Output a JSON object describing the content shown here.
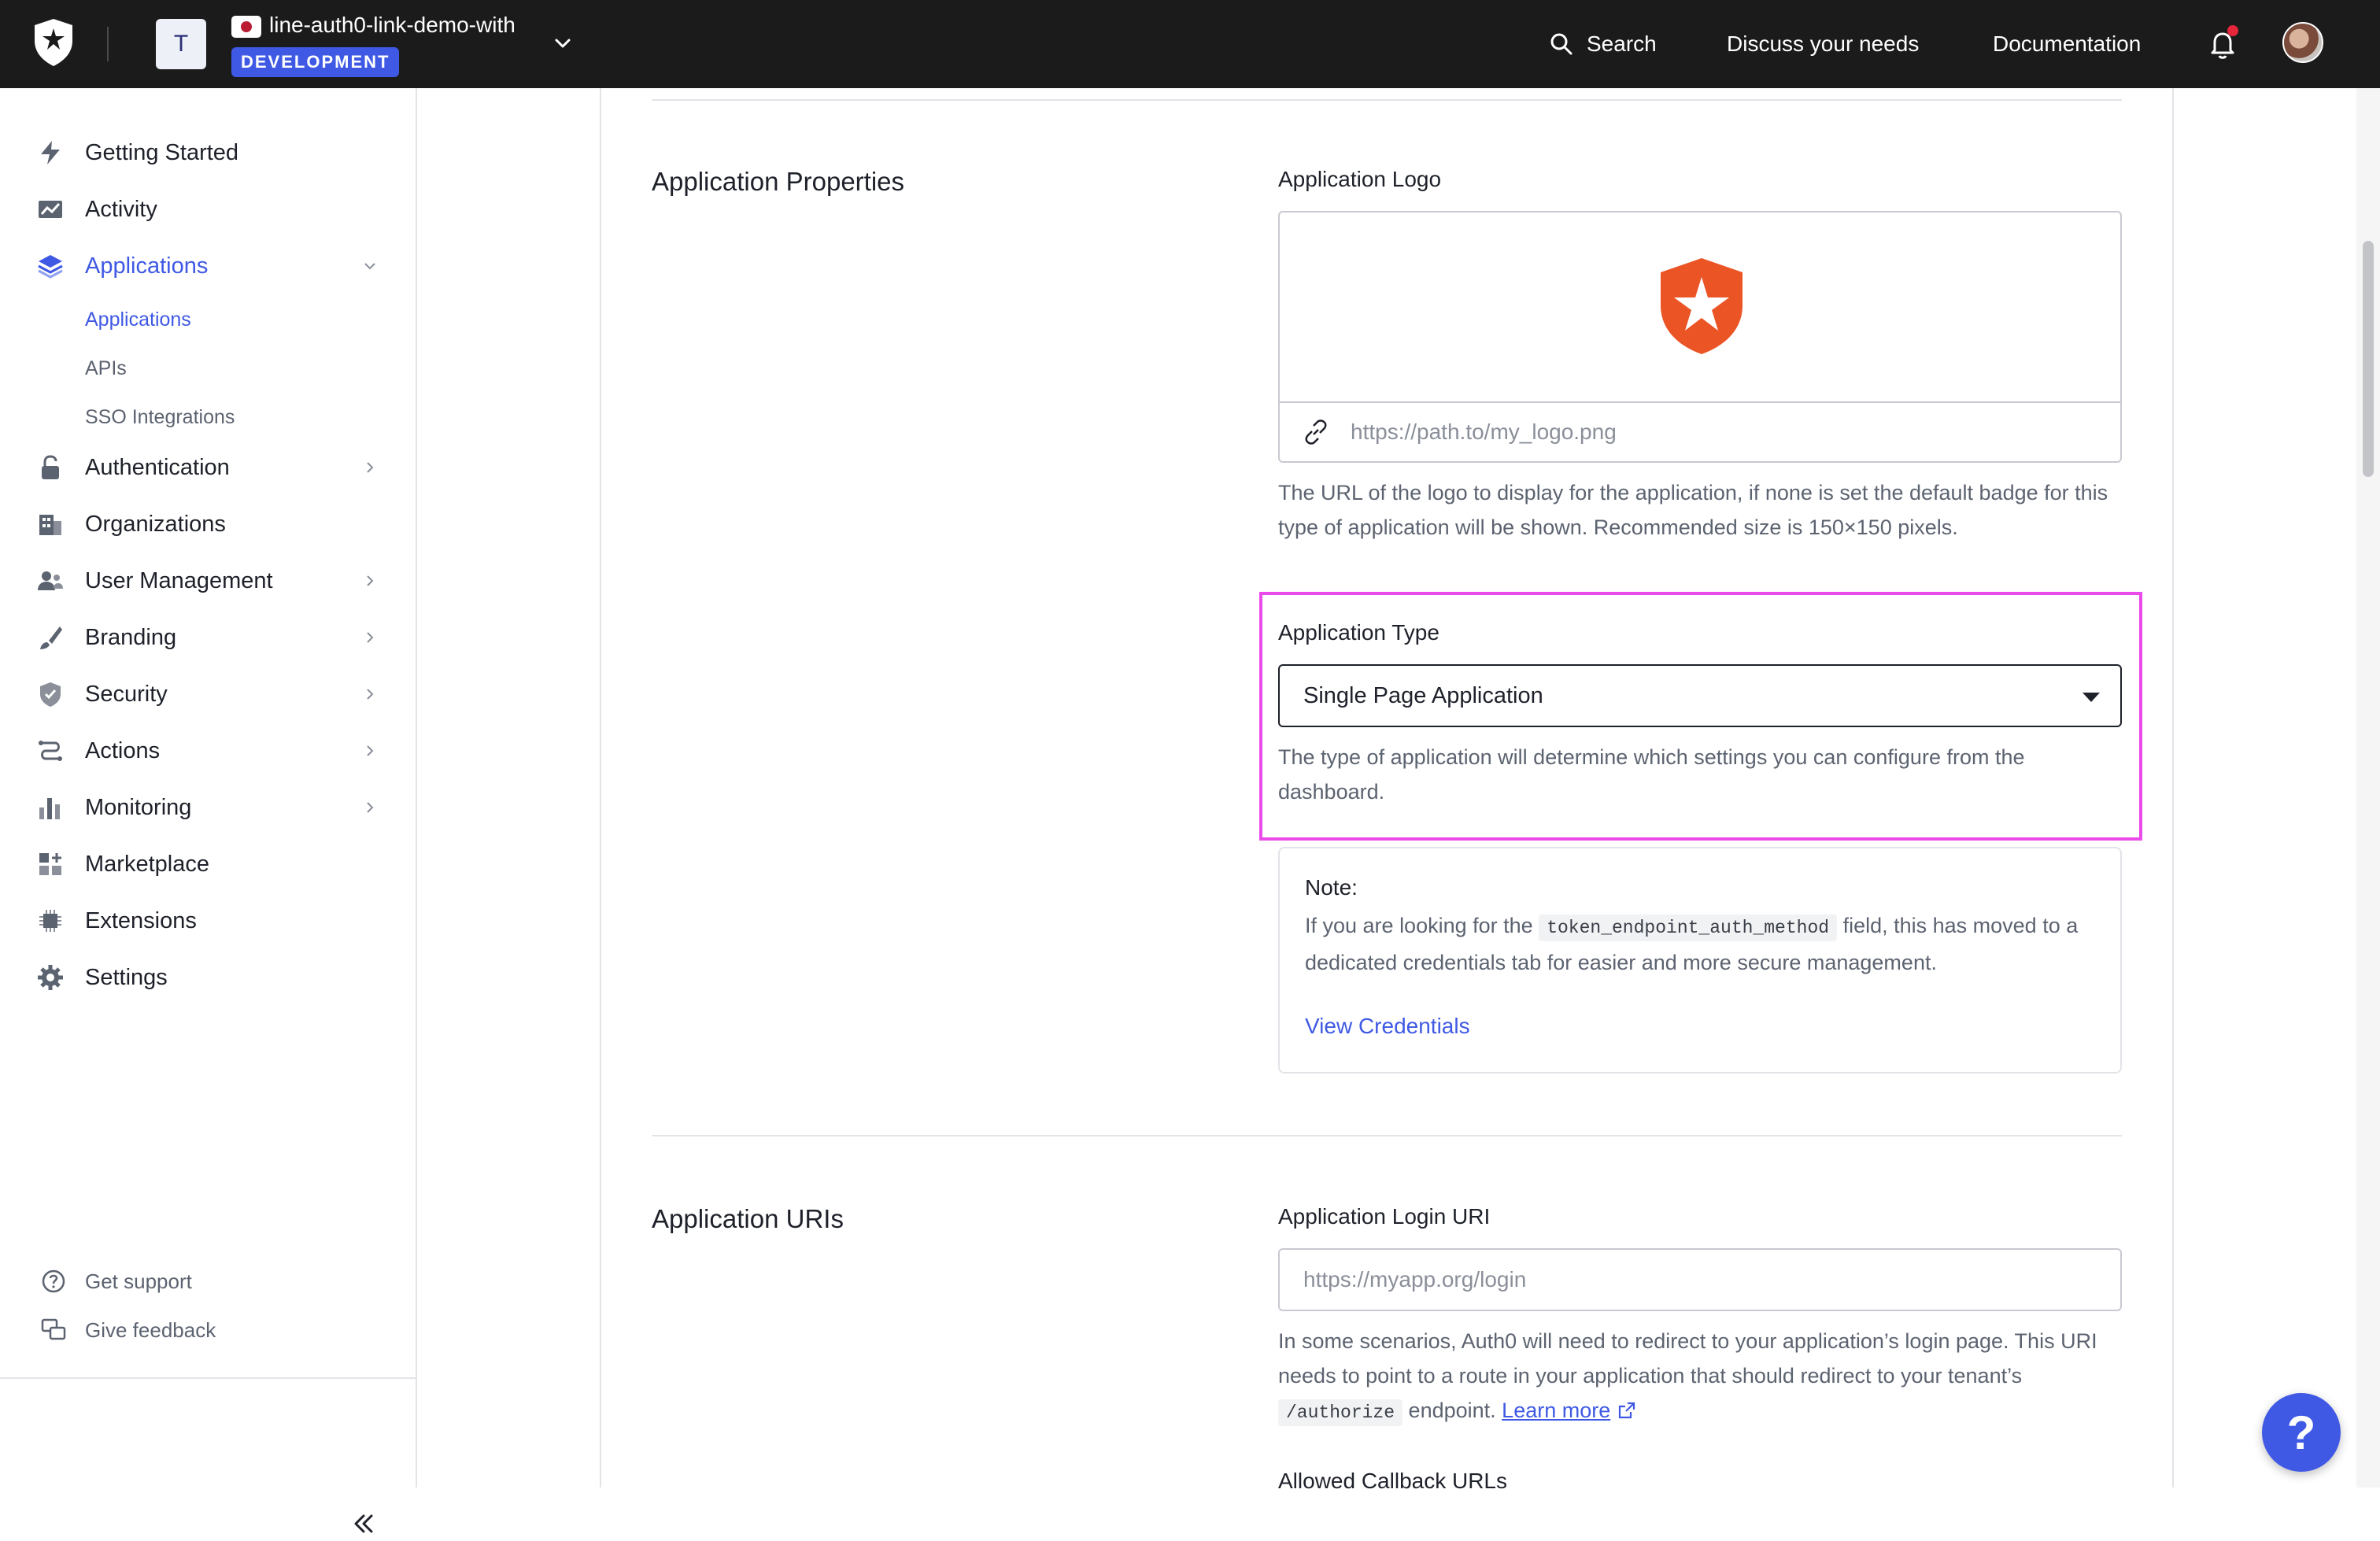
{
  "topbar": {
    "tenant_initial": "T",
    "tenant_name": "line-auth0-link-demo-with",
    "env_badge": "DEVELOPMENT",
    "search_label": "Search",
    "discuss_label": "Discuss your needs",
    "docs_label": "Documentation"
  },
  "sidebar": {
    "items": [
      {
        "label": "Getting Started",
        "icon": "bolt-icon"
      },
      {
        "label": "Activity",
        "icon": "chart-line-icon"
      },
      {
        "label": "Applications",
        "icon": "layers-icon",
        "active": true
      },
      {
        "label": "Authentication",
        "icon": "lock-icon"
      },
      {
        "label": "Organizations",
        "icon": "building-icon"
      },
      {
        "label": "User Management",
        "icon": "users-icon"
      },
      {
        "label": "Branding",
        "icon": "brush-icon"
      },
      {
        "label": "Security",
        "icon": "shield-icon"
      },
      {
        "label": "Actions",
        "icon": "flow-icon"
      },
      {
        "label": "Monitoring",
        "icon": "bar-chart-icon"
      },
      {
        "label": "Marketplace",
        "icon": "grid-plus-icon"
      },
      {
        "label": "Extensions",
        "icon": "chip-icon"
      },
      {
        "label": "Settings",
        "icon": "gear-icon"
      }
    ],
    "sub_items": [
      {
        "label": "Applications",
        "active": true
      },
      {
        "label": "APIs"
      },
      {
        "label": "SSO Integrations"
      }
    ],
    "support": {
      "get_support": "Get support",
      "give_feedback": "Give feedback"
    }
  },
  "main": {
    "properties_title": "Application Properties",
    "logo_label": "Application Logo",
    "logo_placeholder": "https://path.to/my_logo.png",
    "logo_help": "The URL of the logo to display for the application, if none is set the default badge for this type of application will be shown. Recommended size is 150×150 pixels.",
    "type_label": "Application Type",
    "type_value": "Single Page Application",
    "type_help": "The type of application will determine which settings you can configure from the dashboard.",
    "note_title": "Note:",
    "note_text_before": "If you are looking for the",
    "note_code": "token_endpoint_auth_method",
    "note_text_after": "field, this has moved to a dedicated credentials tab for easier and more secure management.",
    "note_link": "View Credentials",
    "uris_title": "Application URIs",
    "login_uri_label": "Application Login URI",
    "login_uri_placeholder": "https://myapp.org/login",
    "login_help_before": "In some scenarios, Auth0 will need to redirect to your application’s login page. This URI needs to point to a route in your application that should redirect to your tenant’s",
    "login_help_code": "/authorize",
    "login_help_after": "endpoint.",
    "learn_more": "Learn more",
    "callback_label": "Allowed Callback URLs"
  },
  "colors": {
    "accent": "#3f59e4",
    "highlight": "#ea4bea",
    "brand_logo": "#eb5424",
    "topbar": "#1b1b1c"
  }
}
